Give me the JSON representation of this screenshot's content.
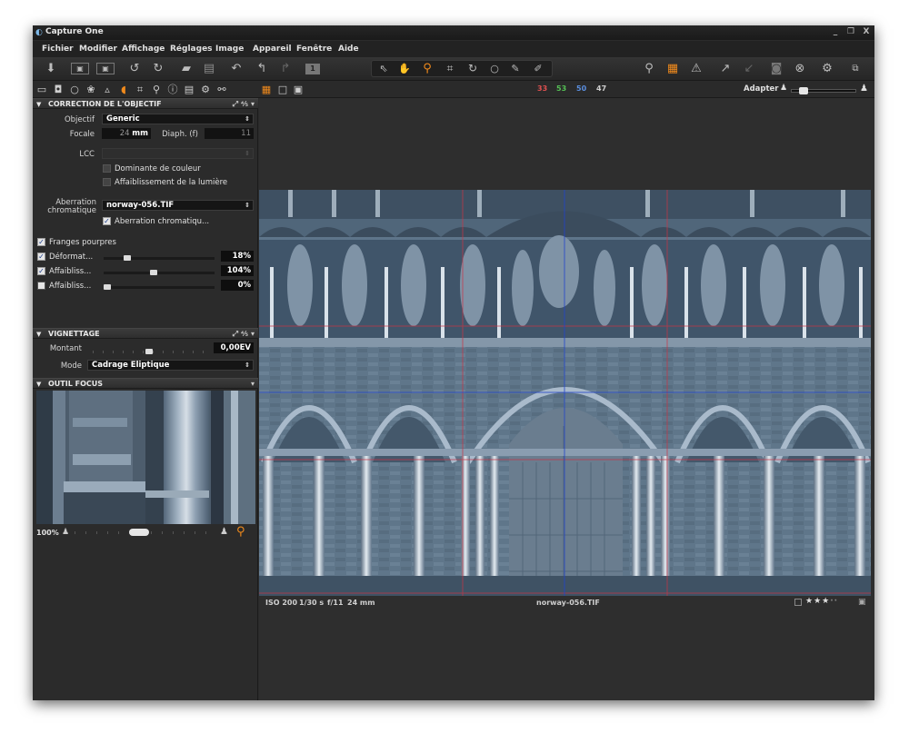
{
  "window": {
    "title": "Capture One",
    "minimize_label": "_",
    "maximize_label": "❐",
    "close_label": "X"
  },
  "menu": [
    "Fichier",
    "Modifier",
    "Affichage",
    "Réglages",
    "Image",
    "Appareil",
    "Fenêtre",
    "Aide"
  ],
  "toolbar": {
    "left_icons": [
      "import-icon",
      "capture-icon",
      "export-icon",
      "rotate-left-icon",
      "rotate-right-icon",
      "move-to-folder-icon",
      "trash-icon",
      "undo-icon",
      "undo-step-icon",
      "redo-icon",
      "variants-icon"
    ],
    "cursor_tools": [
      "pointer-icon",
      "hand-icon",
      "zoom-icon",
      "crop-icon",
      "rotate-icon",
      "spot-removal-icon",
      "color-picker-icon",
      "white-balance-picker-icon"
    ],
    "right_icons": [
      "loupe-icon",
      "grid-icon",
      "exposure-warning-icon",
      "proof-icon",
      "copy-adjustments-icon",
      "camera-icon",
      "reset-icon",
      "settings-icon",
      "histogram-icon"
    ],
    "variant_count": "1"
  },
  "tool_tabs": {
    "icons": [
      "folder-icon",
      "camera-tab-icon",
      "search-tab-icon",
      "color-tab-icon",
      "composition-tab-icon",
      "exposure-tab-icon",
      "lens-tab-icon",
      "crop-tab-icon",
      "details-tab-icon",
      "metadata-tab-icon",
      "output-tab-icon",
      "settings-tab-icon",
      "batch-tab-icon"
    ],
    "view_modes": [
      "grid-view-icon",
      "single-view-icon",
      "compare-view-icon"
    ],
    "counts": [
      {
        "value": "33",
        "color": "#e05050"
      },
      {
        "value": "53",
        "color": "#55c055"
      },
      {
        "value": "50",
        "color": "#5b8fe0"
      },
      {
        "value": "47",
        "color": "#d0d0d0"
      }
    ],
    "fit_label": "Adapter"
  },
  "lens_correction": {
    "title": "CORRECTION DE L'OBJECTIF",
    "objectif_label": "Objectif",
    "objectif_value": "Generic",
    "focale_label": "Focale",
    "focale_value": "24",
    "focale_unit": "mm",
    "diaph_label": "Diaph. (f)",
    "diaph_value": "11",
    "lcc_label": "LCC",
    "color_cast_label": "Dominante de couleur",
    "light_falloff_label": "Affaiblissement de la lumière",
    "aberration_label_1": "Aberration",
    "aberration_label_2": "chromatique",
    "aberration_value": "norway-056.TIF",
    "aberration_check_label": "Aberration chromatiqu...",
    "fringe_label": "Franges pourpres",
    "sliders": [
      {
        "label": "Déformat...",
        "value": "18%",
        "checked": true,
        "fraction": 0.18
      },
      {
        "label": "Affaibliss...",
        "value": "104%",
        "checked": true,
        "fraction": 0.42
      },
      {
        "label": "Affaibliss...",
        "value": "0%",
        "checked": false,
        "fraction": 0.0
      }
    ]
  },
  "vignetting": {
    "title": "VIGNETTAGE",
    "amount_label": "Montant",
    "amount_value": "0,00EV",
    "mode_label": "Mode",
    "mode_value": "Cadrage Eliptique"
  },
  "focus_tool": {
    "title": "OUTIL FOCUS",
    "zoom_value": "100%"
  },
  "image_info": {
    "iso": "ISO 200",
    "shutter": "1/30 s",
    "aperture": "f/11",
    "focal": "24 mm",
    "filename": "norway-056.TIF",
    "rating": 3
  }
}
